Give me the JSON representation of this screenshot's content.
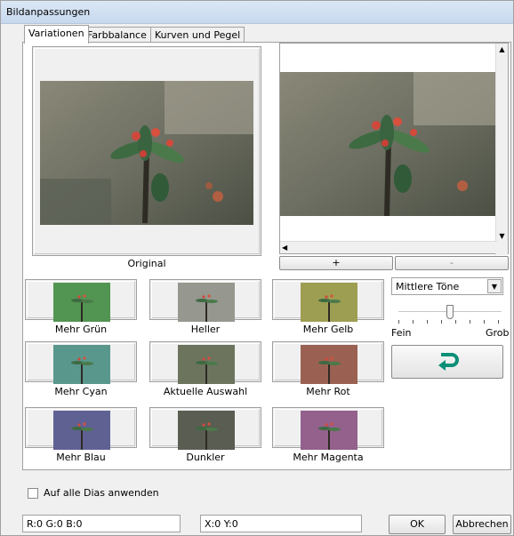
{
  "window": {
    "title": "Bildanpassungen"
  },
  "tabs": [
    {
      "label": "Variationen"
    },
    {
      "label": "Farbbalance"
    },
    {
      "label": "Kurven und Pegel"
    }
  ],
  "original": {
    "label": "Original"
  },
  "zoom": {
    "plus_label": "+",
    "minus_label": "-"
  },
  "variations": [
    {
      "label": "Mehr Grün",
      "tint": "#30c040"
    },
    {
      "label": "Heller",
      "tint": "#c8c8c8"
    },
    {
      "label": "Mehr Gelb",
      "tint": "#d8d840"
    },
    {
      "label": "Mehr Cyan",
      "tint": "#40c8c0"
    },
    {
      "label": "Aktuelle Auswahl",
      "tint": "#6a7a5a"
    },
    {
      "label": "Mehr Rot",
      "tint": "#d05040"
    },
    {
      "label": "Mehr Blau",
      "tint": "#5050d0"
    },
    {
      "label": "Dunkler",
      "tint": "#404840"
    },
    {
      "label": "Mehr Magenta",
      "tint": "#c050c0"
    }
  ],
  "tone_select": {
    "value": "Mittlere Töne"
  },
  "slider": {
    "min_label": "Fein",
    "max_label": "Grob",
    "level": 0.5
  },
  "apply_all": {
    "label": "Auf alle Dias anwenden",
    "checked": false
  },
  "status": {
    "rgb": "R:0 G:0 B:0",
    "xy": "X:0 Y:0"
  },
  "buttons": {
    "ok": "OK",
    "cancel": "Abbrechen"
  }
}
